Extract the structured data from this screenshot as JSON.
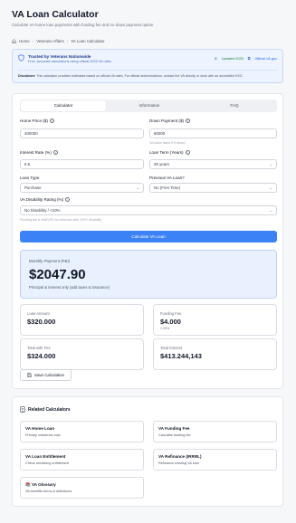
{
  "header": {
    "title": "VA Loan Calculator",
    "subtitle": "Calculate VA home loan payments with funding fee and no down payment option"
  },
  "breadcrumb": [
    "Home",
    "Veterans Affairs",
    "VA Loan Calculator"
  ],
  "trust": {
    "title": "Trusted by Veterans Nationwide",
    "desc": "Free, accurate calculations using official 2025 VA rates",
    "updated": "Updated 2025",
    "official": "Official VA.gov",
    "disclaimer_label": "Disclaimer:",
    "disclaimer": "This calculator provides estimates based on official VA rates. For official determinations, contact the VA directly or work with an accredited VSO."
  },
  "tabs": [
    {
      "label": "Calculator",
      "active": true
    },
    {
      "label": "Information",
      "active": false
    },
    {
      "label": "FAQ",
      "active": false
    }
  ],
  "form": {
    "home_price_label": "Home Price ($)",
    "home_price_value": "400000",
    "down_payment_label": "Down Payment ($)",
    "down_payment_value": "80000",
    "down_payment_hint": "VA loans allow 0% down!",
    "interest_rate_label": "Interest Rate (%)",
    "interest_rate_value": "6.5",
    "loan_term_label": "Loan Term (Years)",
    "loan_term_value": "30 years",
    "loan_type_label": "Loan Type",
    "loan_type_value": "Purchase",
    "previous_loan_label": "Previous VA Loan?",
    "previous_loan_value": "No (First Time)",
    "disability_label": "VA Disability Rating (%)",
    "disability_value": "No Disability / <10%",
    "disability_hint": "Funding fee is WAIVED for veterans with 10%+ disability",
    "calculate_label": "Calculate VA Loan"
  },
  "results": {
    "monthly_label": "Monthly Payment (P&I)",
    "monthly_value": "$2047.90",
    "monthly_note": "Principal & interest only (add taxes & insurance)",
    "loan_amount_label": "Loan Amount",
    "loan_amount_value": "$320.000",
    "funding_fee_label": "Funding Fee",
    "funding_fee_value": "$4.000",
    "funding_fee_sub": "1.25%",
    "total_fee_label": "Total with Fee",
    "total_fee_value": "$324.000",
    "total_interest_label": "Total Interest",
    "total_interest_value": "$413.244,143",
    "save_label": "Save Calculation"
  },
  "related": {
    "title": "Related Calculators",
    "items": [
      {
        "title": "VA Home Loan",
        "desc": "Primary residence loan"
      },
      {
        "title": "VA Funding Fee",
        "desc": "Calculate funding fee"
      },
      {
        "title": "VA Loan Entitlement",
        "desc": "Check remaining entitlement"
      },
      {
        "title": "VA Refinance (IRRRL)",
        "desc": "Refinance existing VA loan"
      },
      {
        "title": "VA Glossary",
        "desc": "VA benefits terms & definitions"
      }
    ]
  },
  "colors": {
    "primary": "#3b82f6",
    "trust_bg": "#eef4ff",
    "result_bg": "#eaf1fe",
    "success": "#15803d"
  }
}
